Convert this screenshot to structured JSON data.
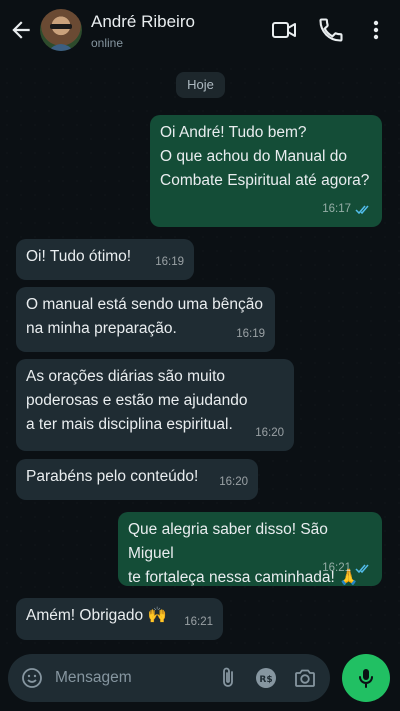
{
  "contact": {
    "name": "André Ribeiro",
    "status": "online"
  },
  "date_chip": "Hoje",
  "messages": [
    {
      "dir": "out",
      "text": "Oi André! Tudo bem?\nO que achou do Manual do\nCombate Espiritual até agora?",
      "time": "16:17",
      "read": true
    },
    {
      "dir": "in",
      "text": "Oi! Tudo ótimo!",
      "time": "16:19"
    },
    {
      "dir": "in",
      "text": "O manual está sendo uma bênção\nna minha preparação.",
      "time": "16:19"
    },
    {
      "dir": "in",
      "text": "As orações diárias são muito\npoderosas e estão me ajudando\na ter mais disciplina espiritual.",
      "time": "16:20"
    },
    {
      "dir": "in",
      "text": "Parabéns pelo conteúdo!",
      "time": "16:20"
    },
    {
      "dir": "out",
      "text": "Que alegria saber disso! São Miguel\nte fortaleça nessa caminhada! 🙏",
      "time": "16:21",
      "read": true
    },
    {
      "dir": "in",
      "text": "Amém! Obrigado 🙌",
      "time": "16:21"
    }
  ],
  "composer": {
    "placeholder": "Mensagem"
  },
  "icons": {
    "back": "arrow-left-icon",
    "video": "video-call-icon",
    "call": "phone-icon",
    "menu": "more-vertical-icon",
    "emoji": "emoji-icon",
    "attach": "paperclip-icon",
    "payment": "real-currency-icon",
    "camera": "camera-icon",
    "mic": "microphone-icon"
  },
  "colors": {
    "outgoing": "#144d37",
    "incoming": "#1f2c33",
    "accent": "#21c063",
    "read_ticks": "#53bdeb"
  }
}
